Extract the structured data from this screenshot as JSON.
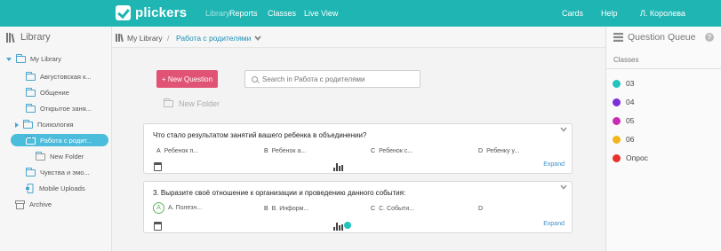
{
  "topbar": {
    "brand": "plickers",
    "nav_left": [
      "Library",
      "Reports",
      "Classes",
      "Live View"
    ],
    "active_nav": "Library",
    "nav_right": [
      "Cards",
      "Help",
      "Л. Королева"
    ],
    "color": "#1fb5b3"
  },
  "sidebar": {
    "title": "Library",
    "items": [
      {
        "label": "My Library",
        "icon": "folder-icon"
      },
      {
        "label": "Августовская к...",
        "icon": "folder-icon"
      },
      {
        "label": "Общение",
        "icon": "folder-icon"
      },
      {
        "label": "Открытое заня...",
        "icon": "folder-icon"
      },
      {
        "label": "Психология",
        "icon": "folder-icon"
      },
      {
        "label": "Работа с родит...",
        "icon": "folder-icon",
        "selected": true
      },
      {
        "label": "New Folder",
        "icon": "new-folder-icon"
      },
      {
        "label": "Чувства и эмо...",
        "icon": "folder-icon"
      },
      {
        "label": "Mobile Uploads",
        "icon": "mobile-icon"
      },
      {
        "label": "Archive",
        "icon": "archive-icon"
      }
    ]
  },
  "breadcrumb": {
    "root": "My Library",
    "separator": "/",
    "current": "Работа с родителями"
  },
  "main": {
    "new_question_label": "+ New Question",
    "search_placeholder": "Search in Работа с родителями",
    "new_folder_label": "New Folder",
    "expand_label": "Expand",
    "questions": [
      {
        "title": "Что стало результатом занятий вашего ребенка в объединении?",
        "answers": [
          {
            "letter": "A",
            "text": "Ребенок п..."
          },
          {
            "letter": "B",
            "text": "Ребенок а..."
          },
          {
            "letter": "C",
            "text": "Ребенок с..."
          },
          {
            "letter": "D",
            "text": "Ребенку у..."
          }
        ]
      },
      {
        "title": "3. Выразите своё отношение к организации и проведению данного события:",
        "answers": [
          {
            "letter": "A",
            "text": "А. Полезн...",
            "correct": true
          },
          {
            "letter": "B",
            "text": "В. Информ..."
          },
          {
            "letter": "C",
            "text": "С. Событи..."
          },
          {
            "letter": "D",
            "text": ""
          }
        ],
        "queued_class_color": "#23c4c0"
      }
    ]
  },
  "queue": {
    "title": "Question Queue",
    "help_icon": "?",
    "classes_label": "Classes",
    "classes": [
      {
        "name": "03",
        "color": "#23c4c0"
      },
      {
        "name": "04",
        "color": "#7b2fd9"
      },
      {
        "name": "05",
        "color": "#c92db4"
      },
      {
        "name": "06",
        "color": "#f2b51c"
      },
      {
        "name": "Опрос",
        "color": "#e8332c"
      }
    ]
  }
}
